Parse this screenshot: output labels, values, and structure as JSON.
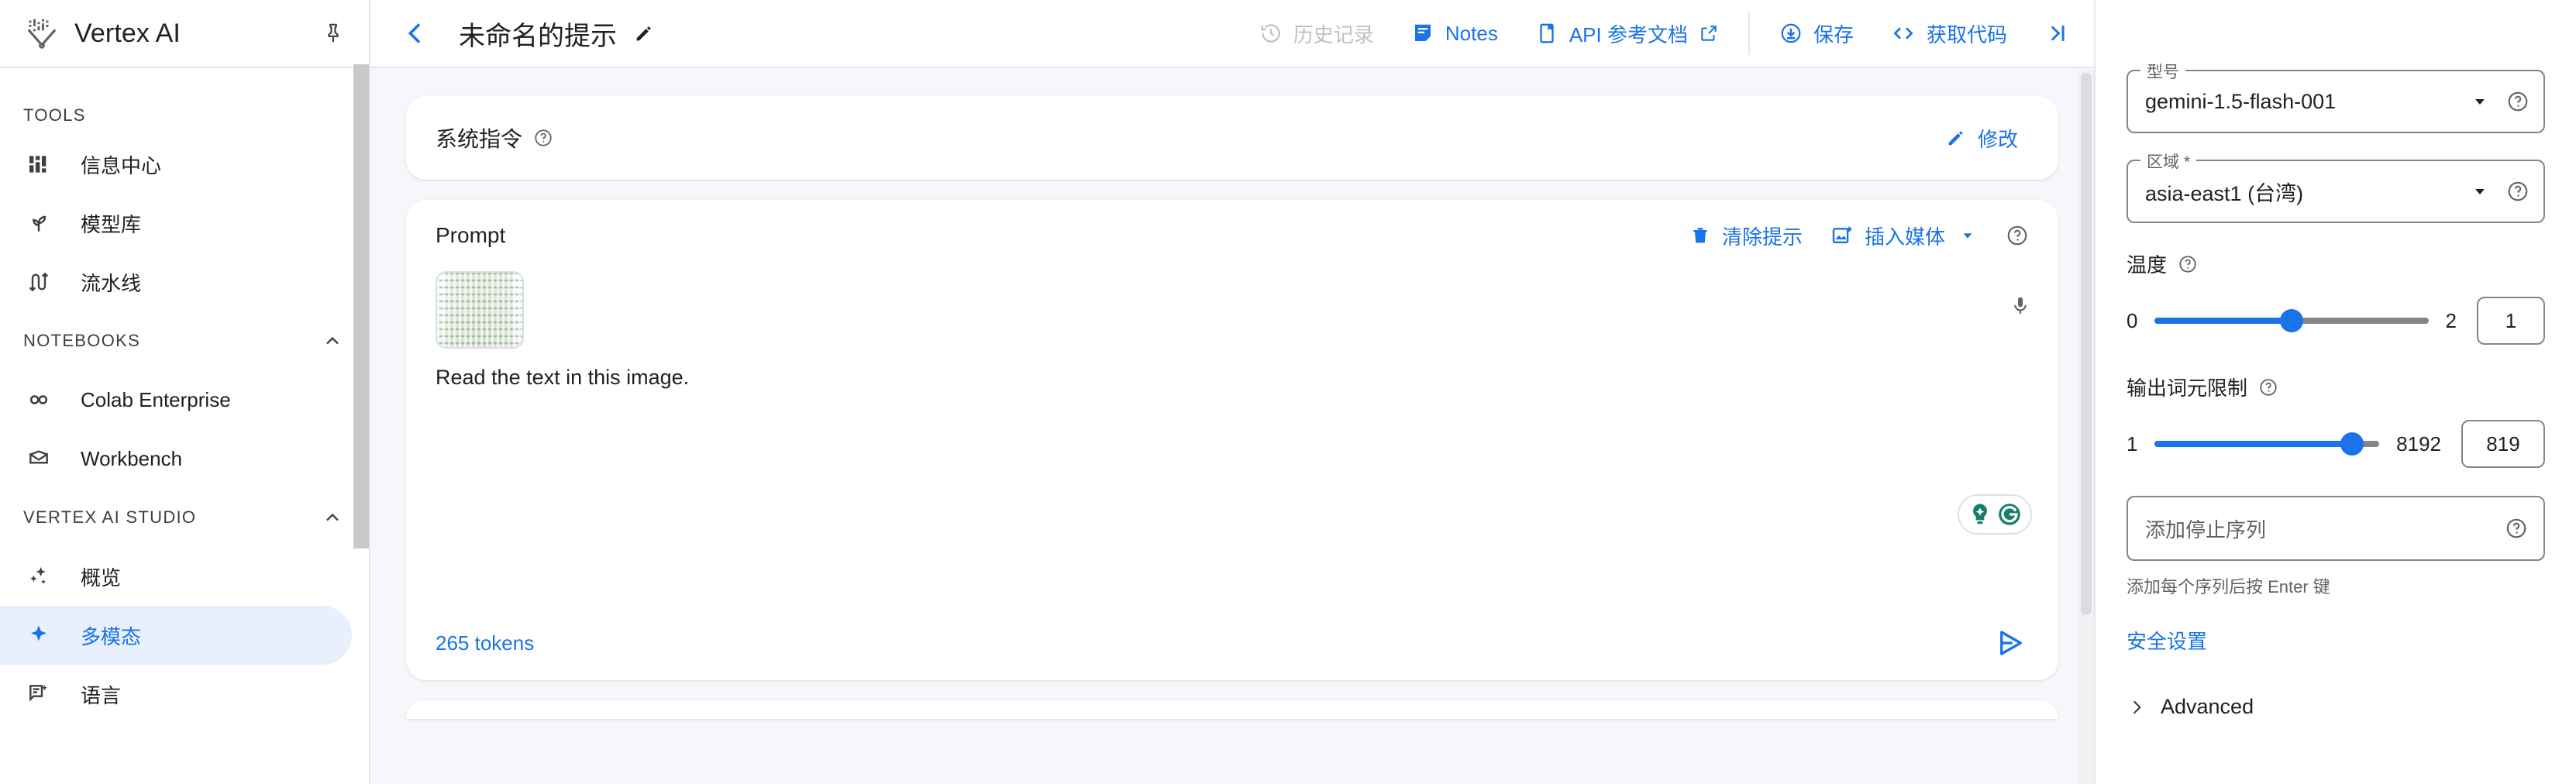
{
  "sidebar": {
    "brand": "Vertex AI",
    "logo_icon": "vertex-ai-logo",
    "pin_icon": "pin-icon",
    "sections": [
      {
        "label": "TOOLS",
        "collapsible": false
      },
      {
        "label": "NOTEBOOKS",
        "collapsible": true,
        "chevron_icon": "chevron-up-icon"
      },
      {
        "label": "VERTEX AI STUDIO",
        "collapsible": true,
        "chevron_icon": "chevron-up-icon"
      }
    ],
    "items": [
      {
        "label": "信息中心",
        "icon": "dashboard-icon",
        "active": false
      },
      {
        "label": "模型库",
        "icon": "model-garden-icon",
        "active": false
      },
      {
        "label": "流水线",
        "icon": "pipelines-icon",
        "active": false
      },
      {
        "label": "Colab Enterprise",
        "icon": "colab-icon",
        "active": false
      },
      {
        "label": "Workbench",
        "icon": "workbench-icon",
        "active": false
      },
      {
        "label": "概览",
        "icon": "sparkle-overview-icon",
        "active": false
      },
      {
        "label": "多模态",
        "icon": "sparkle-icon",
        "active": true
      },
      {
        "label": "语言",
        "icon": "language-chat-icon",
        "active": false
      }
    ]
  },
  "topbar": {
    "back_icon": "arrow-left-icon",
    "title": "未命名的提示",
    "edit_icon": "pencil-icon",
    "history_label": "历史记录",
    "history_icon": "history-icon",
    "notes_label": "Notes",
    "notes_icon": "notes-icon",
    "api_docs_label": "API 参考文档",
    "api_docs_icon": "book-icon",
    "api_docs_external_icon": "open-in-new-icon",
    "save_label": "保存",
    "save_icon": "save-download-icon",
    "get_code_label": "获取代码",
    "get_code_icon": "code-brackets-icon",
    "collapse_panel_icon": "collapse-right-icon"
  },
  "system_instructions": {
    "label": "系统指令",
    "help_icon": "help-circle-icon",
    "edit_label": "修改",
    "edit_icon": "pencil-icon"
  },
  "prompt": {
    "title": "Prompt",
    "clear_label": "清除提示",
    "clear_icon": "trash-icon",
    "insert_media_label": "插入媒体",
    "insert_media_icon": "add-image-icon",
    "insert_media_caret": "caret-down-icon",
    "help_icon": "help-circle-icon",
    "mic_icon": "microphone-icon",
    "attachment_alt": "receipt-thumbnail",
    "text": "Read the text in this image.",
    "token_count": "265 tokens",
    "send_icon": "send-icon",
    "grammarly_icons": [
      "lightbulb-icon",
      "grammarly-g-icon"
    ]
  },
  "settings": {
    "model": {
      "legend": "型号",
      "value": "gemini-1.5-flash-001",
      "caret_icon": "caret-down-icon",
      "help_icon": "help-circle-icon"
    },
    "region": {
      "legend": "区域 *",
      "value": "asia-east1 (台湾)",
      "caret_icon": "caret-down-icon",
      "help_icon": "help-circle-icon"
    },
    "temperature": {
      "label": "温度",
      "help_icon": "help-circle-icon",
      "min": "0",
      "max": "2",
      "value": "1",
      "percent": 50
    },
    "output_token_limit": {
      "label": "输出词元限制",
      "help_icon": "help-circle-icon",
      "min": "1",
      "max": "8192",
      "value": "819",
      "percent": 88
    },
    "stop_sequence": {
      "placeholder": "添加停止序列",
      "value": "",
      "help_icon": "help-circle-icon",
      "hint": "添加每个序列后按 Enter 键"
    },
    "safety_label": "安全设置",
    "advanced_label": "Advanced",
    "advanced_icon": "chevron-right-icon"
  },
  "colors": {
    "accent_blue": "#1a73e8",
    "active_bg": "#e8f0fe",
    "text_primary": "#202124",
    "text_secondary": "#5f6368",
    "disabled": "#bdc1c6",
    "page_bg": "#f6f7fb",
    "border": "#e4e6ea",
    "grammarly_green": "#15806a"
  }
}
